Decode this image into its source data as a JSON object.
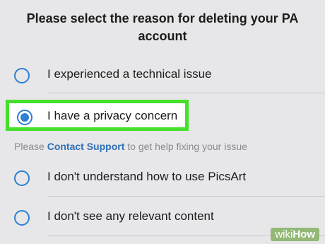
{
  "title": "Please select the reason for deleting your PA account",
  "options": [
    {
      "label": "I experienced a technical issue",
      "selected": false
    },
    {
      "label": "I have a privacy concern",
      "selected": true
    },
    {
      "label": "I don't understand how to use PicsArt",
      "selected": false
    },
    {
      "label": "I don't see any relevant content",
      "selected": false
    }
  ],
  "hint": {
    "prefix": "Please",
    "link": "Contact Support",
    "suffix": "to get help fixing your issue"
  },
  "watermark": {
    "wiki": "wiki",
    "how": "How"
  },
  "colors": {
    "accent": "#2f7fd3",
    "highlight": "#44e02a",
    "background": "#e7e7e9"
  }
}
